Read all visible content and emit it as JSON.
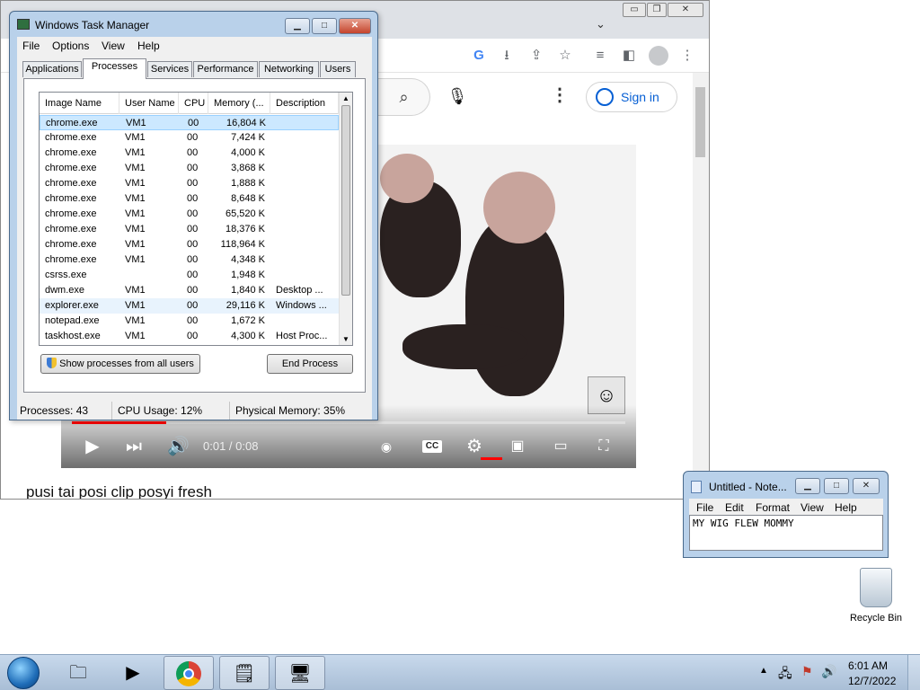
{
  "browser": {
    "window_controls": {
      "minimize": "▭",
      "maximize": "❐",
      "close": "✕"
    },
    "tab_chevron": "⌄",
    "toolbar_icons": [
      "G",
      "⭳",
      "⇪",
      "☆",
      "≡",
      "◧",
      "⋮"
    ],
    "youtube": {
      "search_icon": "⌕",
      "mic_icon": "🎙",
      "more_icon": "⋮",
      "signin_label": "Sign in"
    },
    "video": {
      "time": "0:01 / 0:08",
      "progress": 0.17,
      "title": "pusi tai posi clip posyi fresh"
    }
  },
  "taskmanager": {
    "title": "Windows Task Manager",
    "menu": [
      "File",
      "Options",
      "View",
      "Help"
    ],
    "tabs": [
      "Applications",
      "Processes",
      "Services",
      "Performance",
      "Networking",
      "Users"
    ],
    "active_tab": "Processes",
    "columns": [
      "Image Name",
      "User Name",
      "CPU",
      "Memory (...",
      "Description"
    ],
    "rows": [
      {
        "name": "chrome.exe",
        "user": "VM1",
        "cpu": "00",
        "mem": "16,804 K",
        "desc": ""
      },
      {
        "name": "chrome.exe",
        "user": "VM1",
        "cpu": "00",
        "mem": "7,424 K",
        "desc": ""
      },
      {
        "name": "chrome.exe",
        "user": "VM1",
        "cpu": "00",
        "mem": "4,000 K",
        "desc": ""
      },
      {
        "name": "chrome.exe",
        "user": "VM1",
        "cpu": "00",
        "mem": "3,868 K",
        "desc": ""
      },
      {
        "name": "chrome.exe",
        "user": "VM1",
        "cpu": "00",
        "mem": "1,888 K",
        "desc": ""
      },
      {
        "name": "chrome.exe",
        "user": "VM1",
        "cpu": "00",
        "mem": "8,648 K",
        "desc": ""
      },
      {
        "name": "chrome.exe",
        "user": "VM1",
        "cpu": "00",
        "mem": "65,520 K",
        "desc": ""
      },
      {
        "name": "chrome.exe",
        "user": "VM1",
        "cpu": "00",
        "mem": "18,376 K",
        "desc": ""
      },
      {
        "name": "chrome.exe",
        "user": "VM1",
        "cpu": "00",
        "mem": "118,964 K",
        "desc": ""
      },
      {
        "name": "chrome.exe",
        "user": "VM1",
        "cpu": "00",
        "mem": "4,348 K",
        "desc": ""
      },
      {
        "name": "csrss.exe",
        "user": "",
        "cpu": "00",
        "mem": "1,948 K",
        "desc": ""
      },
      {
        "name": "dwm.exe",
        "user": "VM1",
        "cpu": "00",
        "mem": "1,840 K",
        "desc": "Desktop ..."
      },
      {
        "name": "explorer.exe",
        "user": "VM1",
        "cpu": "00",
        "mem": "29,116 K",
        "desc": "Windows ..."
      },
      {
        "name": "notepad.exe",
        "user": "VM1",
        "cpu": "00",
        "mem": "1,672 K",
        "desc": ""
      },
      {
        "name": "taskhost.exe",
        "user": "VM1",
        "cpu": "00",
        "mem": "4,300 K",
        "desc": "Host Proc..."
      }
    ],
    "selected_row": 0,
    "hover_row": 12,
    "show_all_label": "Show processes from all users",
    "end_process_label": "End Process",
    "status": {
      "processes": "Processes: 43",
      "cpu": "CPU Usage: 12%",
      "memory": "Physical Memory: 35%"
    }
  },
  "notepad": {
    "title": "Untitled - Note...",
    "menu": [
      "File",
      "Edit",
      "Format",
      "View",
      "Help"
    ],
    "content": "MY WIG FLEW MOMMY"
  },
  "desktop": {
    "recycle_bin_label": "Recycle Bin"
  },
  "taskbar": {
    "time": "6:01 AM",
    "date": "12/7/2022",
    "tray_icons": [
      "▲",
      "🖧",
      "⚑",
      "🔊"
    ]
  }
}
